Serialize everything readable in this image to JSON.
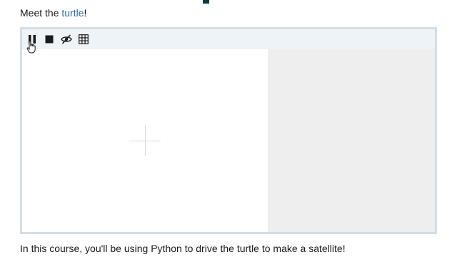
{
  "intro": {
    "prefix": "Meet the ",
    "link_text": "turtle",
    "suffix": "!"
  },
  "toolbar": {
    "buttons": [
      {
        "icon": "pause-icon"
      },
      {
        "icon": "stop-icon"
      },
      {
        "icon": "eye-off-icon"
      },
      {
        "icon": "grid-icon"
      }
    ]
  },
  "colors": {
    "link": "#2a6fa8",
    "widget_border": "#d3dde6",
    "toolbar_bg": "#eef3f8",
    "side_panel_bg": "#eeeeee",
    "icon": "#1a1a1a",
    "top_marker": "#0e3a3a"
  },
  "outro": {
    "text": "In this course, you'll be using Python to drive the turtle to make a satellite!"
  }
}
